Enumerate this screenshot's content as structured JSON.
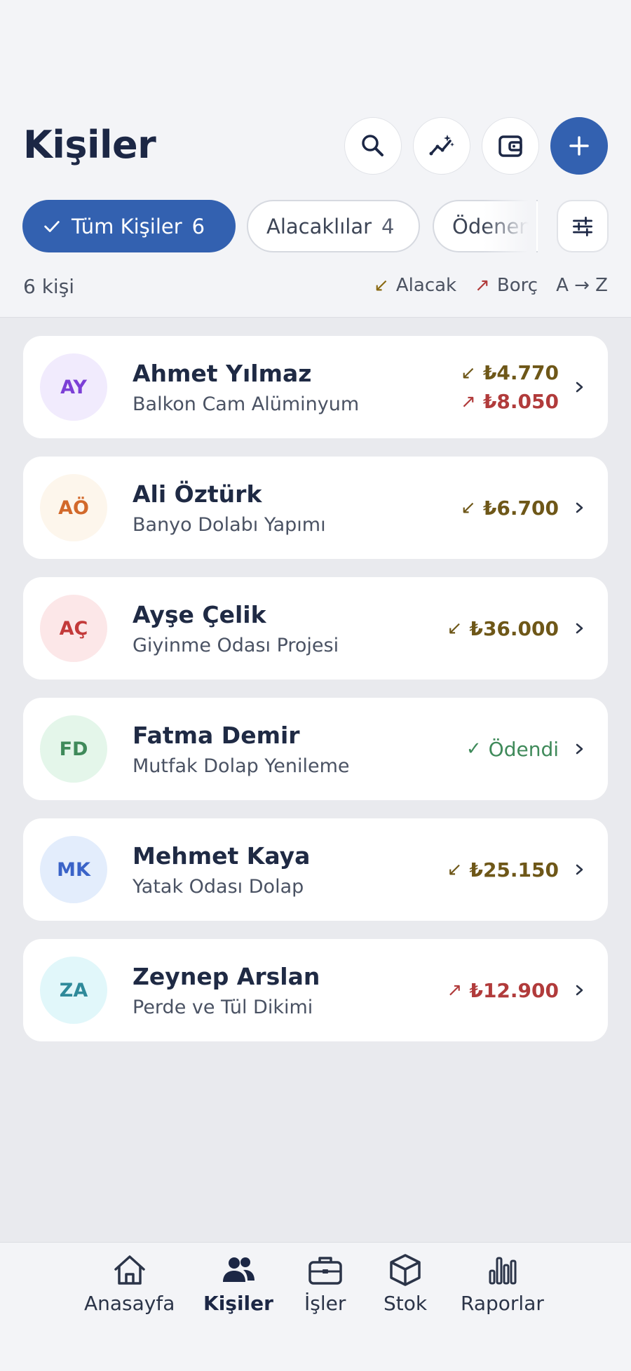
{
  "header": {
    "title": "Kişiler"
  },
  "filters": {
    "chips": [
      {
        "label": "Tüm Kişiler",
        "count": "6"
      },
      {
        "label": "Alacaklılar",
        "count": "4"
      },
      {
        "label": "Ödenen",
        "count": ""
      }
    ]
  },
  "summary": {
    "count_text": "6 kişi",
    "legend_receivable": "Alacak",
    "legend_debt": "Borç",
    "sort_label": "A → Z"
  },
  "contacts": [
    {
      "initials": "AY",
      "name": "Ahmet Yılmaz",
      "subtitle": "Balkon Cam Alüminyum",
      "receivable": "₺4.770",
      "debt": "₺8.050",
      "paid": ""
    },
    {
      "initials": "AÖ",
      "name": "Ali Öztürk",
      "subtitle": "Banyo Dolabı Yapımı",
      "receivable": "₺6.700",
      "debt": "",
      "paid": ""
    },
    {
      "initials": "AÇ",
      "name": "Ayşe Çelik",
      "subtitle": "Giyinme Odası Projesi",
      "receivable": "₺36.000",
      "debt": "",
      "paid": ""
    },
    {
      "initials": "FD",
      "name": "Fatma Demir",
      "subtitle": "Mutfak Dolap Yenileme",
      "receivable": "",
      "debt": "",
      "paid": "Ödendi"
    },
    {
      "initials": "MK",
      "name": "Mehmet Kaya",
      "subtitle": "Yatak Odası Dolap",
      "receivable": "₺25.150",
      "debt": "",
      "paid": ""
    },
    {
      "initials": "ZA",
      "name": "Zeynep Arslan",
      "subtitle": "Perde ve Tül Dikimi",
      "receivable": "",
      "debt": "₺12.900",
      "paid": ""
    }
  ],
  "avatar_colors": [
    {
      "bg": "#f1ebfd",
      "fg": "#7c3fd6"
    },
    {
      "bg": "#fdf6ec",
      "fg": "#d2692b"
    },
    {
      "bg": "#fce7e8",
      "fg": "#c33a3a"
    },
    {
      "bg": "#e4f6ea",
      "fg": "#3f8a5a"
    },
    {
      "bg": "#e3edfc",
      "fg": "#3a63c8"
    },
    {
      "bg": "#e1f7fa",
      "fg": "#2f8a9a"
    }
  ],
  "nav": {
    "items": [
      {
        "label": "Anasayfa",
        "icon": "home-icon"
      },
      {
        "label": "Kişiler",
        "icon": "people-icon"
      },
      {
        "label": "İşler",
        "icon": "briefcase-icon"
      },
      {
        "label": "Stok",
        "icon": "box-icon"
      },
      {
        "label": "Raporlar",
        "icon": "bar-chart-icon"
      }
    ]
  },
  "colors": {
    "primary": "#3361b0",
    "receivable": "#6e5718",
    "debt": "#b13b3b",
    "paid": "#3f8a5a"
  }
}
